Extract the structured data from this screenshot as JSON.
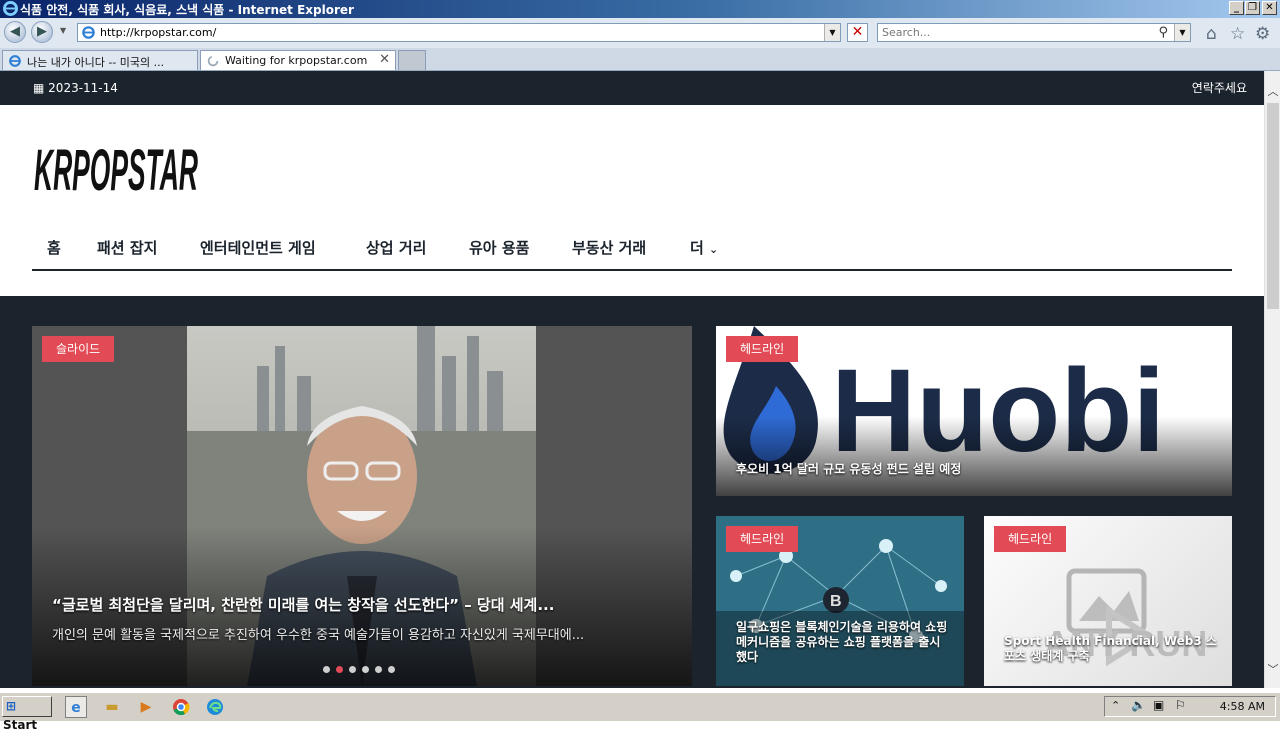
{
  "window": {
    "title": "식품 안전, 식품 회사, 식음료, 스낵 식품 - Internet Explorer",
    "buttons": {
      "minimize": "_",
      "restore": "❐",
      "close": "✕"
    }
  },
  "address_bar": {
    "url": "http://krpopstar.com/"
  },
  "search_box": {
    "placeholder": "Search..."
  },
  "tabs": [
    {
      "label": "나는 내가 아니다 -- 미국의 ...",
      "active": false
    },
    {
      "label": "Waiting for krpopstar.com",
      "active": true
    }
  ],
  "site": {
    "date": "2023-11-14",
    "contact": "연락주세요",
    "logo_text": "KRPOPSTAR",
    "menu": [
      "홈",
      "패션 잡지",
      "엔터테인먼트 게임",
      "상업 거리",
      "유아 용품",
      "부동산 거래",
      "더"
    ],
    "slider": {
      "badge": "슬라이드",
      "title": "“글로벌 최첨단을 달리며, 찬란한 미래를 여는 창작을 선도한다” – 당대 세계...",
      "description": "개인의 문예 활동을 국제적으로 추진하여 우수한 중국 예술가들이 용감하고 자신있게 국제무대에...",
      "dots_count": 6,
      "active_dot": 1
    },
    "headline_cards": [
      {
        "badge": "헤드라인",
        "logo_text": "Huobi",
        "caption": "후오비 1억 달러 규모 유동성 펀드 설립 예정"
      },
      {
        "badge": "헤드라인",
        "caption": "일구쇼핑은 블록체인기술을 리용하여 쇼핑 메커니즘을 공유하는 쇼핑 플랫폼을 출시했다"
      },
      {
        "badge": "헤드라인",
        "caption": "Sport Health Financial, Web3 스포츠 생태계 구축",
        "watermark": "ANY RUN"
      }
    ]
  },
  "taskbar": {
    "start_label": "Start",
    "clock": "4:58 AM"
  },
  "colors": {
    "accent": "#e24b55",
    "dark": "#1b232d"
  }
}
